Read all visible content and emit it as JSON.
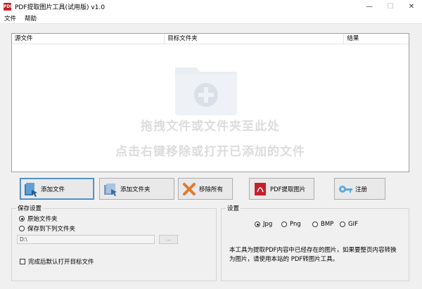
{
  "window": {
    "title": "PDF提取图片工具(试用版) v1.0",
    "app_icon_text": "PDF",
    "controls": {
      "minimize": "—",
      "maximize": "☐",
      "close": "✕"
    }
  },
  "menu": {
    "items": [
      "文件",
      "帮助"
    ]
  },
  "list": {
    "columns": [
      "源文件",
      "目标文件夹",
      "结果"
    ],
    "hint_line1": "拖拽文件或文件夹至此处",
    "hint_line2": "点击右键移除或打开已添加的文件"
  },
  "toolbar": {
    "add_file": "添加文件",
    "add_folder": "添加文件夹",
    "remove_all": "移除所有",
    "extract": "PDF提取图片",
    "register": "注册"
  },
  "save_settings": {
    "title": "保存设置",
    "option_original": "原始文件夹",
    "option_custom": "保存到下列文件夹",
    "selected": "original",
    "path": "D:\\",
    "browse_label": "...",
    "open_after": "完成后默认打开目标文件",
    "open_after_checked": false
  },
  "settings": {
    "title": "设置",
    "formats": [
      "Jpg",
      "Png",
      "BMP",
      "GIF"
    ],
    "selected_format": "Jpg",
    "description": "本工具为提取PDF内容中已经存在的图片，如果要整页内容转换为图片，请使用本站的 PDF转图片工具。"
  },
  "colors": {
    "accent": "#3c7fb1",
    "hint_text": "#dcdcdc"
  }
}
